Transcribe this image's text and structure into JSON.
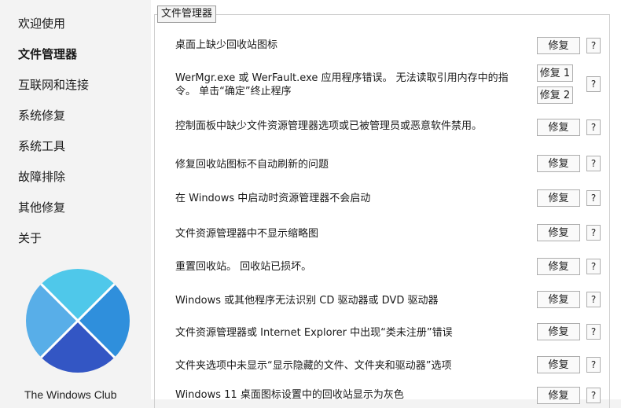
{
  "sidebar": {
    "items": [
      {
        "label": "欢迎使用"
      },
      {
        "label": "文件管理器"
      },
      {
        "label": "互联网和连接"
      },
      {
        "label": "系统修复"
      },
      {
        "label": "系统工具"
      },
      {
        "label": "故障排除"
      },
      {
        "label": "其他修复"
      },
      {
        "label": "关于"
      }
    ],
    "active_index": 1,
    "brand": "The Windows Club",
    "logo_colors": [
      "#4fc3e8",
      "#2a8fd8",
      "#3a62c9",
      "#5aa9e6"
    ]
  },
  "panel": {
    "group_title": "文件管理器",
    "fix_label": "修复",
    "fix1_label": "修复 1",
    "fix2_label": "修复 2",
    "help_label": "?",
    "rows": [
      {
        "label": "桌面上缺少回收站图标"
      },
      {
        "label": "WerMgr.exe 或 WerFault.exe 应用程序错误。 无法读取引用内存中的指令。 单击“确定”终止程序"
      },
      {
        "label": "控制面板中缺少文件资源管理器选项或已被管理员或恶意软件禁用。"
      },
      {
        "label": "修复回收站图标不自动刷新的问题"
      },
      {
        "label": "在 Windows 中启动时资源管理器不会启动"
      },
      {
        "label": "文件资源管理器中不显示缩略图"
      },
      {
        "label": "重置回收站。 回收站已损坏。"
      },
      {
        "label": "Windows 或其他程序无法识别 CD 驱动器或 DVD 驱动器"
      },
      {
        "label": "文件资源管理器或 Internet Explorer 中出现“类未注册”错误"
      },
      {
        "label": "文件夹选项中未显示“显示隐藏的文件、文件夹和驱动器”选项"
      },
      {
        "label": "Windows 11 桌面图标设置中的回收站显示为灰色"
      }
    ]
  }
}
